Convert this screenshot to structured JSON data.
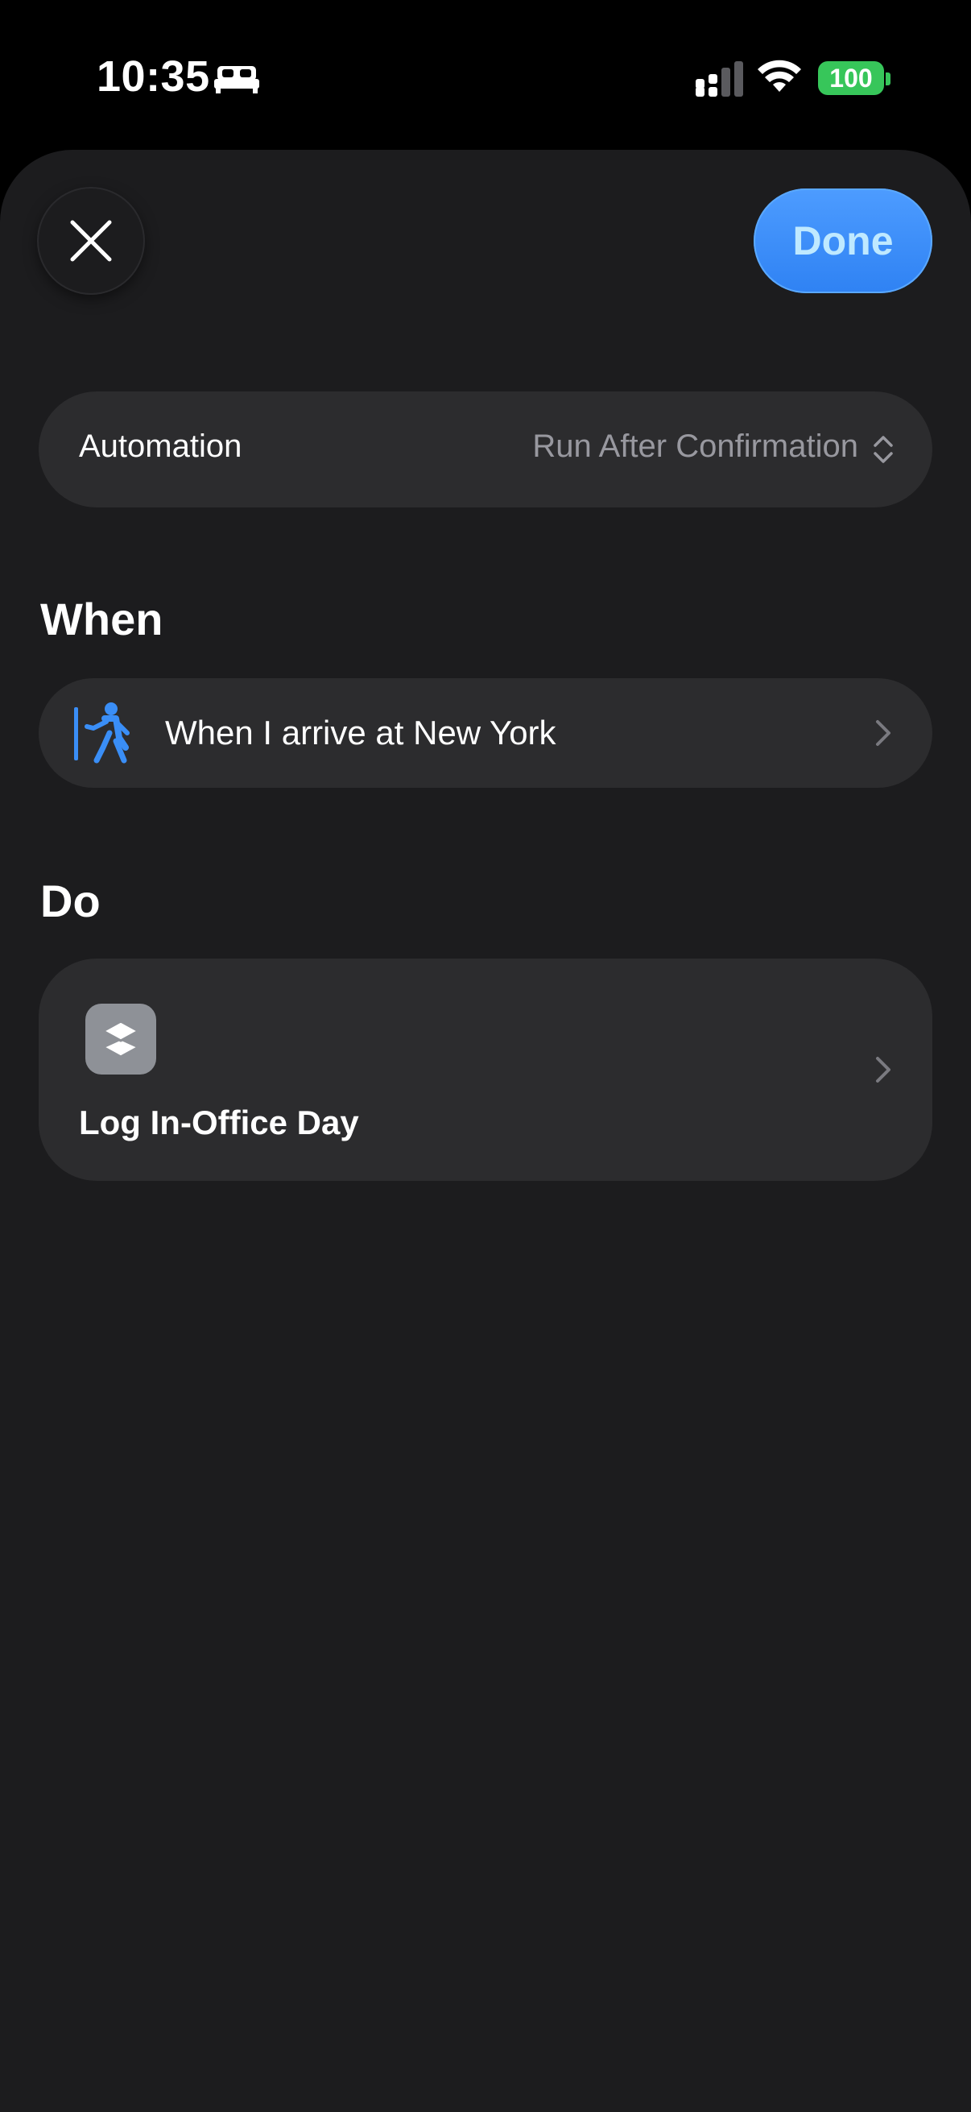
{
  "status_bar": {
    "time": "10:35",
    "battery": "100",
    "icons": [
      "bed-icon",
      "cellular-signal-icon",
      "wifi-icon",
      "battery-icon"
    ]
  },
  "header": {
    "close_icon": "xmark-icon",
    "done_label": "Done"
  },
  "automation": {
    "label": "Automation",
    "value": "Run After Confirmation",
    "icon": "chevron-up-down-icon"
  },
  "when_section": {
    "title": "When",
    "trigger": {
      "icon": "walking-arrive-icon",
      "text": "When I arrive at New York"
    }
  },
  "do_section": {
    "title": "Do",
    "action": {
      "icon": "shortcuts-layers-icon",
      "title": "Log In-Office Day"
    }
  },
  "colors": {
    "background": "#000000",
    "sheet": "#1c1c1e",
    "row": "#2c2c2e",
    "accent": "#3a8ef6",
    "done_text": "#bfe9ff",
    "secondary_text": "#98989f",
    "battery": "#37c65a"
  }
}
